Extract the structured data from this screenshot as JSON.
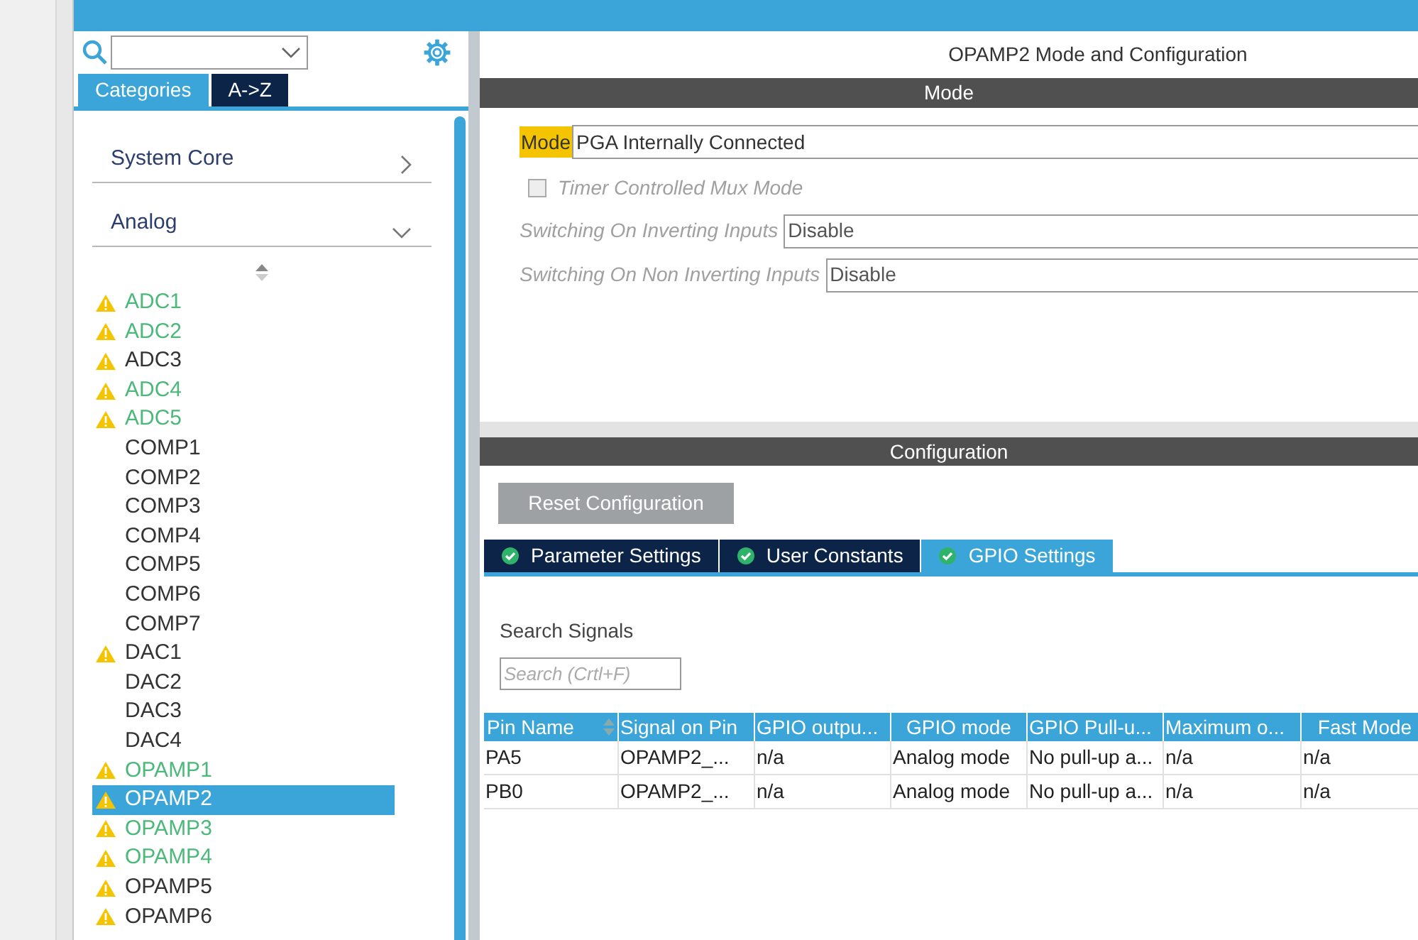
{
  "sidebar": {
    "tabs": [
      {
        "label": "Categories",
        "selected": true
      },
      {
        "label": "A->Z",
        "selected": false
      }
    ],
    "categories": [
      {
        "label": "System Core",
        "expanded": false
      },
      {
        "label": "Analog",
        "expanded": true
      }
    ],
    "items": [
      {
        "label": "ADC1",
        "warning": true,
        "configured": true,
        "selected": false
      },
      {
        "label": "ADC2",
        "warning": true,
        "configured": true,
        "selected": false
      },
      {
        "label": "ADC3",
        "warning": true,
        "configured": false,
        "selected": false
      },
      {
        "label": "ADC4",
        "warning": true,
        "configured": true,
        "selected": false
      },
      {
        "label": "ADC5",
        "warning": true,
        "configured": true,
        "selected": false
      },
      {
        "label": "COMP1",
        "warning": false,
        "configured": false,
        "selected": false
      },
      {
        "label": "COMP2",
        "warning": false,
        "configured": false,
        "selected": false
      },
      {
        "label": "COMP3",
        "warning": false,
        "configured": false,
        "selected": false
      },
      {
        "label": "COMP4",
        "warning": false,
        "configured": false,
        "selected": false
      },
      {
        "label": "COMP5",
        "warning": false,
        "configured": false,
        "selected": false
      },
      {
        "label": "COMP6",
        "warning": false,
        "configured": false,
        "selected": false
      },
      {
        "label": "COMP7",
        "warning": false,
        "configured": false,
        "selected": false
      },
      {
        "label": "DAC1",
        "warning": true,
        "configured": false,
        "selected": false
      },
      {
        "label": "DAC2",
        "warning": false,
        "configured": false,
        "selected": false
      },
      {
        "label": "DAC3",
        "warning": false,
        "configured": false,
        "selected": false
      },
      {
        "label": "DAC4",
        "warning": false,
        "configured": false,
        "selected": false
      },
      {
        "label": "OPAMP1",
        "warning": true,
        "configured": true,
        "selected": false
      },
      {
        "label": "OPAMP2",
        "warning": true,
        "selected": true
      },
      {
        "label": "OPAMP3",
        "warning": true,
        "configured": true,
        "selected": false
      },
      {
        "label": "OPAMP4",
        "warning": true,
        "configured": true,
        "selected": false
      },
      {
        "label": "OPAMP5",
        "warning": true,
        "configured": false,
        "selected": false
      },
      {
        "label": "OPAMP6",
        "warning": true,
        "configured": false,
        "selected": false
      }
    ]
  },
  "main": {
    "title": "OPAMP2 Mode and Configuration",
    "mode_header": "Mode",
    "mode": {
      "label": "Mode",
      "value": "PGA Internally Connected"
    },
    "timer_mux": {
      "label": "Timer Controlled Mux Mode",
      "checked": false,
      "disabled": true
    },
    "fields": [
      {
        "label": "Switching On Inverting Inputs",
        "value": "Disable",
        "disabled": true
      },
      {
        "label": "Switching On Non Inverting Inputs",
        "value": "Disable",
        "disabled": true
      }
    ],
    "config_header": "Configuration",
    "reset_button": "Reset Configuration",
    "tabs": [
      {
        "label": "Parameter Settings",
        "selected": false
      },
      {
        "label": "User Constants",
        "selected": false
      },
      {
        "label": "GPIO Settings",
        "selected": true
      }
    ],
    "search_label": "Search Signals",
    "search": {
      "placeholder": "Search (Crtl+F)"
    },
    "table": {
      "columns": [
        "Pin Name",
        "Signal on Pin",
        "GPIO outpu...",
        "GPIO mode",
        "GPIO Pull-u...",
        "Maximum o...",
        "Fast Mode"
      ],
      "rows": [
        [
          "PA5",
          "OPAMP2_...",
          "n/a",
          "Analog mode",
          "No pull-up a...",
          "n/a",
          "n/a"
        ],
        [
          "PB0",
          "OPAMP2_...",
          "n/a",
          "Analog mode",
          "No pull-up a...",
          "n/a",
          "n/a"
        ]
      ]
    }
  }
}
